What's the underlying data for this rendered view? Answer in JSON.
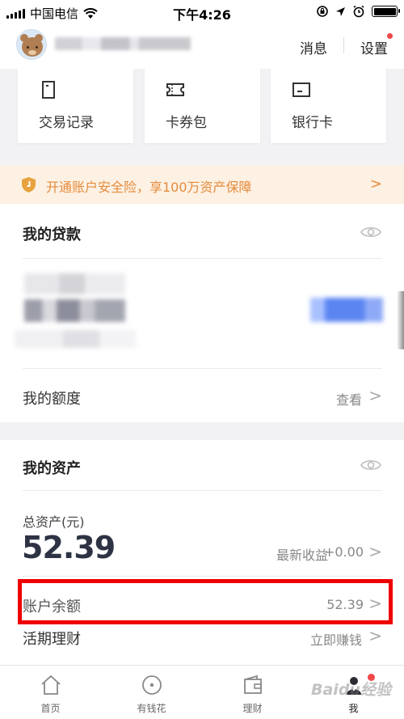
{
  "status_bar": {
    "carrier": "中国电信",
    "time": "下午4:26"
  },
  "header": {
    "messages_label": "消息",
    "settings_label": "设置"
  },
  "quick_actions": [
    {
      "label": "交易记录",
      "icon": "document-icon"
    },
    {
      "label": "卡券包",
      "icon": "ticket-icon"
    },
    {
      "label": "银行卡",
      "icon": "bank-card-icon"
    }
  ],
  "banner": {
    "text": "开通账户安全险，享100万资产保障",
    "chevron": ">"
  },
  "loans": {
    "title": "我的贷款",
    "credit_label": "我的额度",
    "credit_action": "查看",
    "chevron": ">"
  },
  "assets": {
    "title": "我的资产",
    "total_label": "总资产(元)",
    "total_value": "52.39",
    "earnings_label": "最新收益",
    "earnings_value": "+0.00",
    "balance_label": "账户余额",
    "balance_value": "52.39",
    "flexible_label": "活期理财",
    "flexible_action": "立即赚钱",
    "chevron": ">"
  },
  "tabbar": {
    "items": [
      {
        "label": "首页",
        "icon": "home-icon"
      },
      {
        "label": "有钱花",
        "icon": "circle-dot-icon"
      },
      {
        "label": "理财",
        "icon": "wallet-icon"
      },
      {
        "label": "我",
        "icon": "profile-icon"
      }
    ]
  },
  "watermark": "Baidu经验",
  "colors": {
    "accent_orange": "#e58b3c",
    "banner_bg": "#fdf1e3",
    "highlight_red": "#ee0000",
    "amount_dark": "#2e3344"
  }
}
